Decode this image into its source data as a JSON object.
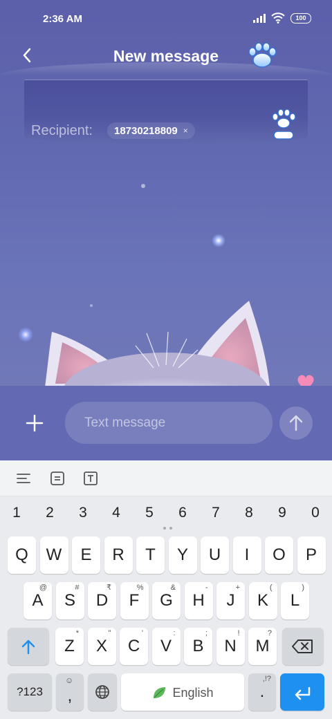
{
  "status_bar": {
    "time": "2:36 AM",
    "battery": "100"
  },
  "header": {
    "title": "New message",
    "back_icon": "back-arrow-icon",
    "action_icon": "paw-icon"
  },
  "recipient": {
    "label": "Recipient:",
    "number": "18730218809",
    "remove": "×"
  },
  "compose": {
    "placeholder": "Text message"
  },
  "keyboard": {
    "numbers": [
      "1",
      "2",
      "3",
      "4",
      "5",
      "6",
      "7",
      "8",
      "9",
      "0"
    ],
    "row1": [
      {
        "k": "Q"
      },
      {
        "k": "W"
      },
      {
        "k": "E"
      },
      {
        "k": "R"
      },
      {
        "k": "T"
      },
      {
        "k": "Y"
      },
      {
        "k": "U"
      },
      {
        "k": "I"
      },
      {
        "k": "O"
      },
      {
        "k": "P"
      }
    ],
    "row2": [
      {
        "k": "A",
        "s": "@"
      },
      {
        "k": "S",
        "s": "#"
      },
      {
        "k": "D",
        "s": "₹"
      },
      {
        "k": "F",
        "s": "%"
      },
      {
        "k": "G",
        "s": "&"
      },
      {
        "k": "H",
        "s": "-"
      },
      {
        "k": "J",
        "s": "+"
      },
      {
        "k": "K",
        "s": "("
      },
      {
        "k": "L",
        "s": ")"
      }
    ],
    "row3": [
      {
        "k": "Z",
        "s": "*"
      },
      {
        "k": "X",
        "s": "\""
      },
      {
        "k": "C",
        "s": "'"
      },
      {
        "k": "V",
        "s": ":"
      },
      {
        "k": "B",
        "s": ";"
      },
      {
        "k": "N",
        "s": "!"
      },
      {
        "k": "M",
        "s": "?"
      }
    ],
    "symbols_key": "?123",
    "comma_key": ",",
    "space_label": "English",
    "period_key": ".",
    "period_sup": ",!?"
  },
  "colors": {
    "accent": "#1e90f0",
    "scene": "#5c5fa9",
    "keyboard_bg": "#e9ebee"
  }
}
